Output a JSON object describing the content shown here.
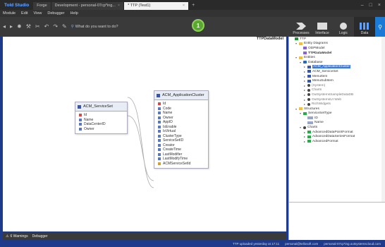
{
  "titlebar": {
    "app_title": "Told Studio",
    "tabs": [
      {
        "label": "Forge",
        "active": false
      },
      {
        "label": "Development - personal-07cp*ing...",
        "active": false
      },
      {
        "label": "* TTP (Test1)",
        "active": true
      }
    ],
    "add_tab": "+",
    "window_controls": [
      "–",
      "□",
      "×"
    ]
  },
  "menubar": {
    "items": [
      "Module",
      "Edit",
      "View",
      "Debugger",
      "Help"
    ]
  },
  "toolbar": {
    "search_placeholder": "What do you want to do?",
    "publish_badge": "1"
  },
  "right_tools": [
    {
      "label": "Processes",
      "icon": "processes-icon"
    },
    {
      "label": "Interface",
      "icon": "interface-icon"
    },
    {
      "label": "Logic",
      "icon": "logic-icon"
    },
    {
      "label": "Data",
      "icon": "data-icon",
      "active": true
    }
  ],
  "canvas": {
    "model_name": "TTPDataModel",
    "entities": [
      {
        "name": "ACM_ServiceSet",
        "attributes": [
          {
            "name": "Id",
            "kind": "pk"
          },
          {
            "name": "Name",
            "kind": "attr"
          },
          {
            "name": "DataCenterID",
            "kind": "attr"
          },
          {
            "name": "Owner",
            "kind": "attr"
          }
        ]
      },
      {
        "name": "ACM_ApplicationCluster",
        "attributes": [
          {
            "name": "Id",
            "kind": "pk"
          },
          {
            "name": "Code",
            "kind": "attr"
          },
          {
            "name": "Name",
            "kind": "attr"
          },
          {
            "name": "Owner",
            "kind": "attr"
          },
          {
            "name": "AppID",
            "kind": "attr"
          },
          {
            "name": "IsEnable",
            "kind": "attr"
          },
          {
            "name": "IsVirtual",
            "kind": "attr"
          },
          {
            "name": "ClusterType",
            "kind": "attr"
          },
          {
            "name": "ServiceSetID",
            "kind": "attr"
          },
          {
            "name": "Creator",
            "kind": "attr"
          },
          {
            "name": "CreateTime",
            "kind": "attr"
          },
          {
            "name": "LastModifier",
            "kind": "attr"
          },
          {
            "name": "LastModifyTime",
            "kind": "attr"
          },
          {
            "name": "ACMServiceSetId",
            "kind": "fk"
          }
        ]
      }
    ]
  },
  "bottom_panel": {
    "warnings_label": "6 Warnings",
    "debugger_label": "Debugger"
  },
  "status": {
    "items": [
      "TTP uploaded yesterday at 17:11",
      "personal@tellosoft.com",
      "personal-07cp*ing.outsystemscloud.com"
    ]
  },
  "tree": [
    {
      "label": "TTP",
      "level": 0,
      "icon": "module",
      "caret": "",
      "style": ""
    },
    {
      "label": "Entity Diagrams",
      "level": 1,
      "icon": "folder",
      "caret": "▾",
      "style": ""
    },
    {
      "label": "ODPModel",
      "level": 2,
      "icon": "diagram",
      "caret": "",
      "style": ""
    },
    {
      "label": "TTPDataModel",
      "level": 2,
      "icon": "diagram",
      "caret": "",
      "style": "bold"
    },
    {
      "label": "Entities",
      "level": 1,
      "icon": "folder",
      "caret": "▾",
      "style": ""
    },
    {
      "label": "Database",
      "level": 2,
      "icon": "db",
      "caret": "▾",
      "style": ""
    },
    {
      "label": "ACM_ApplicationCluster",
      "level": 3,
      "icon": "table",
      "caret": "▸",
      "style": "sel"
    },
    {
      "label": "ACM_ServiceSet",
      "level": 3,
      "icon": "table",
      "caret": "▸",
      "style": ""
    },
    {
      "label": "MenuItem",
      "level": 3,
      "icon": "table",
      "caret": "▸",
      "style": ""
    },
    {
      "label": "MenuSubItem",
      "level": 3,
      "icon": "table",
      "caret": "▸",
      "style": ""
    },
    {
      "label": "(System)",
      "level": 3,
      "icon": "external",
      "caret": "▸",
      "style": "muted"
    },
    {
      "label": "Charts",
      "level": 3,
      "icon": "external",
      "caret": "▸",
      "style": "muted"
    },
    {
      "label": "OutSystemsSampleDataDB",
      "level": 3,
      "icon": "external",
      "caret": "▸",
      "style": "muted"
    },
    {
      "label": "OutSystemsUI Web",
      "level": 3,
      "icon": "external",
      "caret": "▸",
      "style": "muted"
    },
    {
      "label": "RichWidgets",
      "level": 3,
      "icon": "external",
      "caret": "▸",
      "style": "muted"
    },
    {
      "label": "Structures",
      "level": 1,
      "icon": "folder",
      "caret": "▾",
      "style": ""
    },
    {
      "label": "ServiceSetType",
      "level": 2,
      "icon": "struct",
      "caret": "▾",
      "style": ""
    },
    {
      "label": "ID",
      "level": 3,
      "icon": "attr",
      "caret": "",
      "style": ""
    },
    {
      "label": "Name",
      "level": 3,
      "icon": "attr",
      "caret": "",
      "style": ""
    },
    {
      "label": "Charts",
      "level": 2,
      "icon": "external",
      "caret": "▾",
      "style": ""
    },
    {
      "label": "AdvancedDataPointFormat",
      "level": 3,
      "icon": "struct",
      "caret": "▸",
      "style": ""
    },
    {
      "label": "AdvancedDataSeriesFormat",
      "level": 3,
      "icon": "struct",
      "caret": "▸",
      "style": ""
    },
    {
      "label": "AdvancedFormat",
      "level": 3,
      "icon": "struct",
      "caret": "▸",
      "style": ""
    }
  ]
}
